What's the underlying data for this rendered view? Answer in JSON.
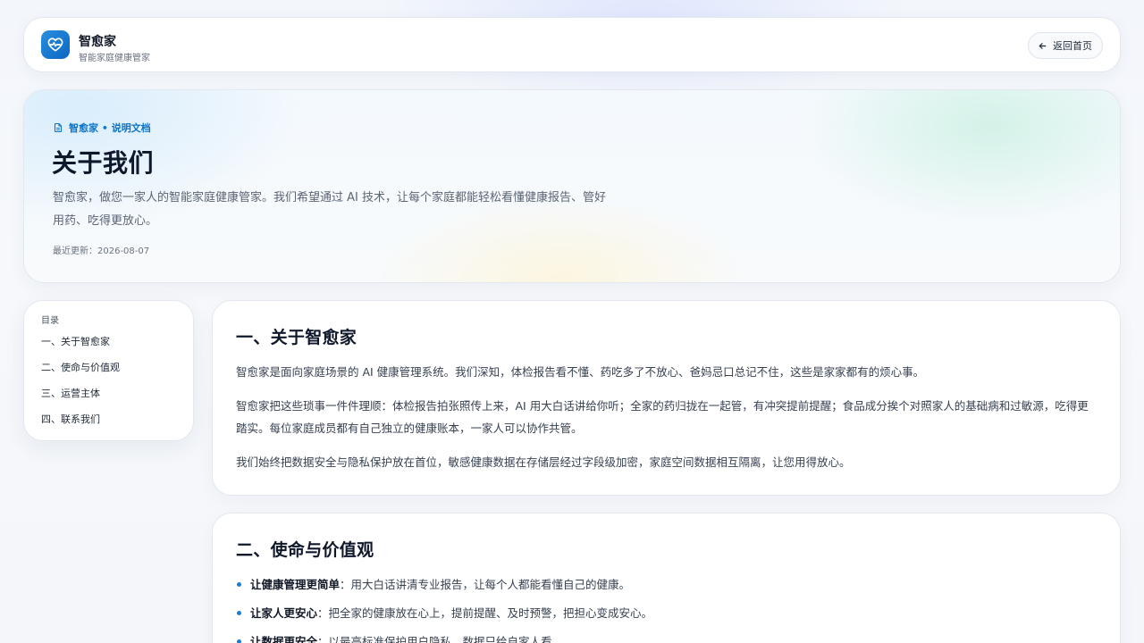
{
  "header": {
    "brand_name": "智愈家",
    "brand_sub": "智能家庭健康管家",
    "back_label": "返回首页"
  },
  "hero": {
    "tag": "智愈家 • 说明文档",
    "title": "关于我们",
    "description": "智愈家，做您一家人的智能家庭健康管家。我们希望通过 AI 技术，让每个家庭都能轻松看懂健康报告、管好用药、吃得更放心。",
    "updated": "最近更新：2026-08-07"
  },
  "toc": {
    "title": "目录",
    "items": [
      "一、关于智愈家",
      "二、使命与价值观",
      "三、运营主体",
      "四、联系我们"
    ]
  },
  "section1": {
    "title": "一、关于智愈家",
    "paragraphs": [
      "智愈家是面向家庭场景的 AI 健康管理系统。我们深知，体检报告看不懂、药吃多了不放心、爸妈忌口总记不住，这些是家家都有的烦心事。",
      "智愈家把这些琐事一件件理顺：体检报告拍张照传上来，AI 用大白话讲给你听；全家的药归拢在一起管，有冲突提前提醒；食品成分挨个对照家人的基础病和过敏源，吃得更踏实。每位家庭成员都有自己独立的健康账本，一家人可以协作共管。",
      "我们始终把数据安全与隐私保护放在首位，敏感健康数据在存储层经过字段级加密，家庭空间数据相互隔离，让您用得放心。"
    ]
  },
  "section2": {
    "title": "二、使命与价值观",
    "bullets": [
      {
        "bold": "让健康管理更简单",
        "text": "：用大白话讲清专业报告，让每个人都能看懂自己的健康。"
      },
      {
        "bold": "让家人更安心",
        "text": "：把全家的健康放在心上，提前提醒、及时预警，把担心变成安心。"
      },
      {
        "bold": "让数据更安全",
        "text": "：以最高标准保护用户隐私，数据只给自家人看。"
      }
    ]
  },
  "colors": {
    "accent": "#0d74c7",
    "logo_gradient_start": "#2a8fe0",
    "logo_gradient_end": "#0a66c2"
  }
}
